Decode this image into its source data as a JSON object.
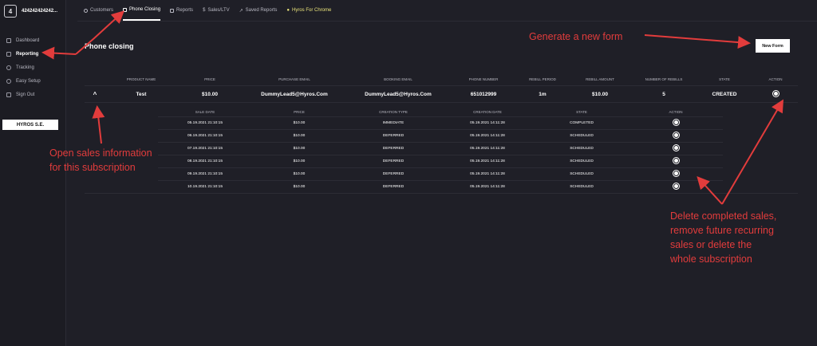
{
  "account": {
    "badge": "4",
    "name": "424242424242..."
  },
  "sidebar": {
    "items": [
      {
        "label": "Dashboard",
        "icon": "dashboard-icon"
      },
      {
        "label": "Reporting",
        "icon": "reporting-icon"
      },
      {
        "label": "Tracking",
        "icon": "tracking-icon"
      },
      {
        "label": "Easy Setup",
        "icon": "setup-icon"
      },
      {
        "label": "Sign Out",
        "icon": "sign-out-icon"
      }
    ],
    "company": "HYROS S.E."
  },
  "tabs": [
    {
      "label": "Customers"
    },
    {
      "label": "Phone Closing"
    },
    {
      "label": "Reports"
    },
    {
      "label": "Sales/LTV"
    },
    {
      "label": "Saved Reports"
    },
    {
      "label": "Hyros For Chrome"
    }
  ],
  "page": {
    "title": "Phone closing",
    "new_form": "New Form"
  },
  "main_table": {
    "headers": [
      "",
      "PRODUCT NAME",
      "PRICE",
      "PURCHASE EMAIL",
      "BOOKING EMAIL",
      "PHONE NUMBER",
      "REBILL PERIOD",
      "REBILL AMOUNT",
      "NUMBER OF REBILLS",
      "STATE",
      "ACTION"
    ],
    "row": {
      "product": "Test",
      "price": "$10.00",
      "purchase_email": "DummyLead5@Hyros.Com",
      "booking_email": "DummyLead5@Hyros.Com",
      "phone": "651012999",
      "period": "1m",
      "amount": "$10.00",
      "rebills": "5",
      "state": "CREATED"
    }
  },
  "sub_table": {
    "headers": [
      "SALE DATE",
      "PRICE",
      "CREATION TYPE",
      "CREATION DATE",
      "STATE",
      "ACTION"
    ],
    "rows": [
      {
        "date": "05.19.2021 21:10:15",
        "price": "$10.00",
        "type": "IMMEDIATE",
        "created": "05.19.2021 14:11:28",
        "state": "COMPLETED"
      },
      {
        "date": "06.19.2021 21:10:15",
        "price": "$10.00",
        "type": "DEFERRED",
        "created": "05.19.2021 14:11:28",
        "state": "SCHEDULED"
      },
      {
        "date": "07.19.2021 21:10:15",
        "price": "$10.00",
        "type": "DEFERRED",
        "created": "05.19.2021 14:11:28",
        "state": "SCHEDULED"
      },
      {
        "date": "08.19.2021 21:10:15",
        "price": "$10.00",
        "type": "DEFERRED",
        "created": "05.19.2021 14:11:28",
        "state": "SCHEDULED"
      },
      {
        "date": "09.19.2021 21:10:15",
        "price": "$10.00",
        "type": "DEFERRED",
        "created": "05.19.2021 14:11:28",
        "state": "SCHEDULED"
      },
      {
        "date": "10.19.2021 21:10:15",
        "price": "$10.00",
        "type": "DEFERRED",
        "created": "05.19.2021 14:11:28",
        "state": "SCHEDULED"
      }
    ]
  },
  "annotations": {
    "generate": "Generate a new form",
    "open_1": "Open sales information",
    "open_2": "for this subscription",
    "delete_1": "Delete completed sales,",
    "delete_2": "remove future recurring",
    "delete_3": "sales or delete the",
    "delete_4": "whole subscription"
  },
  "colors": {
    "background": "#1f1f27",
    "annotation": "#e23c3c",
    "chrome_tab": "#e9e37a"
  }
}
